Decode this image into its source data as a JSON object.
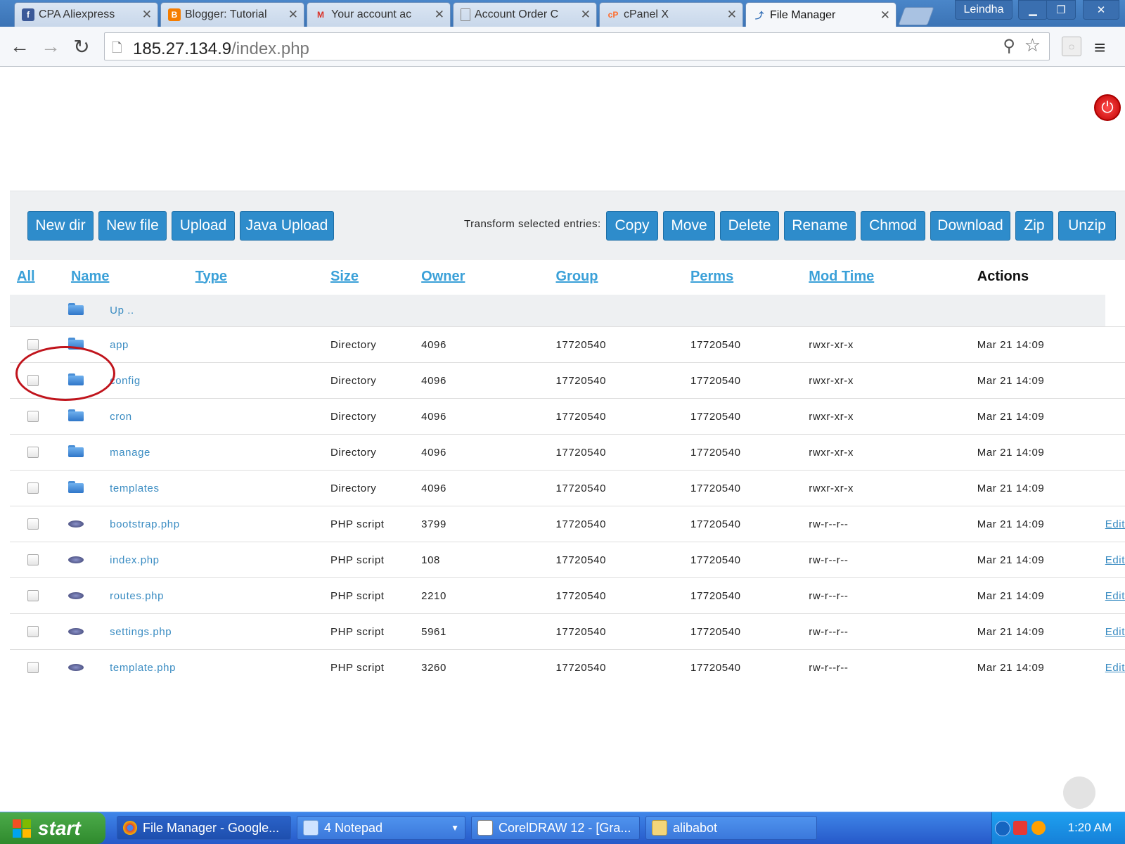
{
  "browser": {
    "tabs": [
      {
        "title": "CPA Aliexpress",
        "icon": "facebook-icon"
      },
      {
        "title": "Blogger: Tutorial",
        "icon": "blogger-icon"
      },
      {
        "title": "Your account ac",
        "icon": "gmail-icon"
      },
      {
        "title": "Account Order C",
        "icon": "page-icon"
      },
      {
        "title": "cPanel X",
        "icon": "cpanel-icon"
      },
      {
        "title": "File Manager",
        "icon": "file-manager-icon",
        "active": true
      }
    ],
    "user": "Leindha",
    "url_host": "185.27.134.9",
    "url_path": "/index.php"
  },
  "toolbar": {
    "buttons": [
      "New dir",
      "New file",
      "Upload",
      "Java Upload"
    ],
    "transform_label": "Transform selected entries:",
    "transform_buttons": [
      "Copy",
      "Move",
      "Delete",
      "Rename",
      "Chmod",
      "Download",
      "Zip",
      "Unzip"
    ]
  },
  "table": {
    "headers": {
      "all": "All",
      "name": "Name",
      "type": "Type",
      "size": "Size",
      "owner": "Owner",
      "group": "Group",
      "perms": "Perms",
      "mtime": "Mod Time",
      "actions": "Actions"
    },
    "up_label": "Up ..",
    "rows": [
      {
        "name": "app",
        "type": "Directory",
        "size": "4096",
        "owner": "17720540",
        "group": "17720540",
        "perms": "rwxr-xr-x",
        "mtime": "Mar 21 14:09",
        "action": "",
        "kind": "folder"
      },
      {
        "name": "config",
        "type": "Directory",
        "size": "4096",
        "owner": "17720540",
        "group": "17720540",
        "perms": "rwxr-xr-x",
        "mtime": "Mar 21 14:09",
        "action": "",
        "kind": "folder"
      },
      {
        "name": "cron",
        "type": "Directory",
        "size": "4096",
        "owner": "17720540",
        "group": "17720540",
        "perms": "rwxr-xr-x",
        "mtime": "Mar 21 14:09",
        "action": "",
        "kind": "folder"
      },
      {
        "name": "manage",
        "type": "Directory",
        "size": "4096",
        "owner": "17720540",
        "group": "17720540",
        "perms": "rwxr-xr-x",
        "mtime": "Mar 21 14:09",
        "action": "",
        "kind": "folder"
      },
      {
        "name": "templates",
        "type": "Directory",
        "size": "4096",
        "owner": "17720540",
        "group": "17720540",
        "perms": "rwxr-xr-x",
        "mtime": "Mar 21 14:09",
        "action": "",
        "kind": "folder"
      },
      {
        "name": "bootstrap.php",
        "type": "PHP script",
        "size": "3799",
        "owner": "17720540",
        "group": "17720540",
        "perms": "rw-r--r--",
        "mtime": "Mar 21 14:09",
        "action": "Edit",
        "kind": "script"
      },
      {
        "name": "index.php",
        "type": "PHP script",
        "size": "108",
        "owner": "17720540",
        "group": "17720540",
        "perms": "rw-r--r--",
        "mtime": "Mar 21 14:09",
        "action": "Edit",
        "kind": "script"
      },
      {
        "name": "routes.php",
        "type": "PHP script",
        "size": "2210",
        "owner": "17720540",
        "group": "17720540",
        "perms": "rw-r--r--",
        "mtime": "Mar 21 14:09",
        "action": "Edit",
        "kind": "script"
      },
      {
        "name": "settings.php",
        "type": "PHP script",
        "size": "5961",
        "owner": "17720540",
        "group": "17720540",
        "perms": "rw-r--r--",
        "mtime": "Mar 21 14:09",
        "action": "Edit",
        "kind": "script"
      },
      {
        "name": "template.php",
        "type": "PHP script",
        "size": "3260",
        "owner": "17720540",
        "group": "17720540",
        "perms": "rw-r--r--",
        "mtime": "Mar 21 14:09",
        "action": "Edit",
        "kind": "script"
      }
    ]
  },
  "taskbar": {
    "start_label": "start",
    "tasks": [
      {
        "label": "File Manager - Google...",
        "icon": "chrome-icon"
      },
      {
        "label": "4 Notepad",
        "icon": "notepad-icon"
      },
      {
        "label": "CorelDRAW 12 - [Gra...",
        "icon": "coreldraw-icon"
      },
      {
        "label": "alibabot",
        "icon": "folder-icon"
      }
    ],
    "clock": "1:20 AM"
  },
  "colors": {
    "button_blue": "#2e8ccb",
    "link_blue": "#3aa0d8",
    "highlight_red": "#c0141c"
  }
}
